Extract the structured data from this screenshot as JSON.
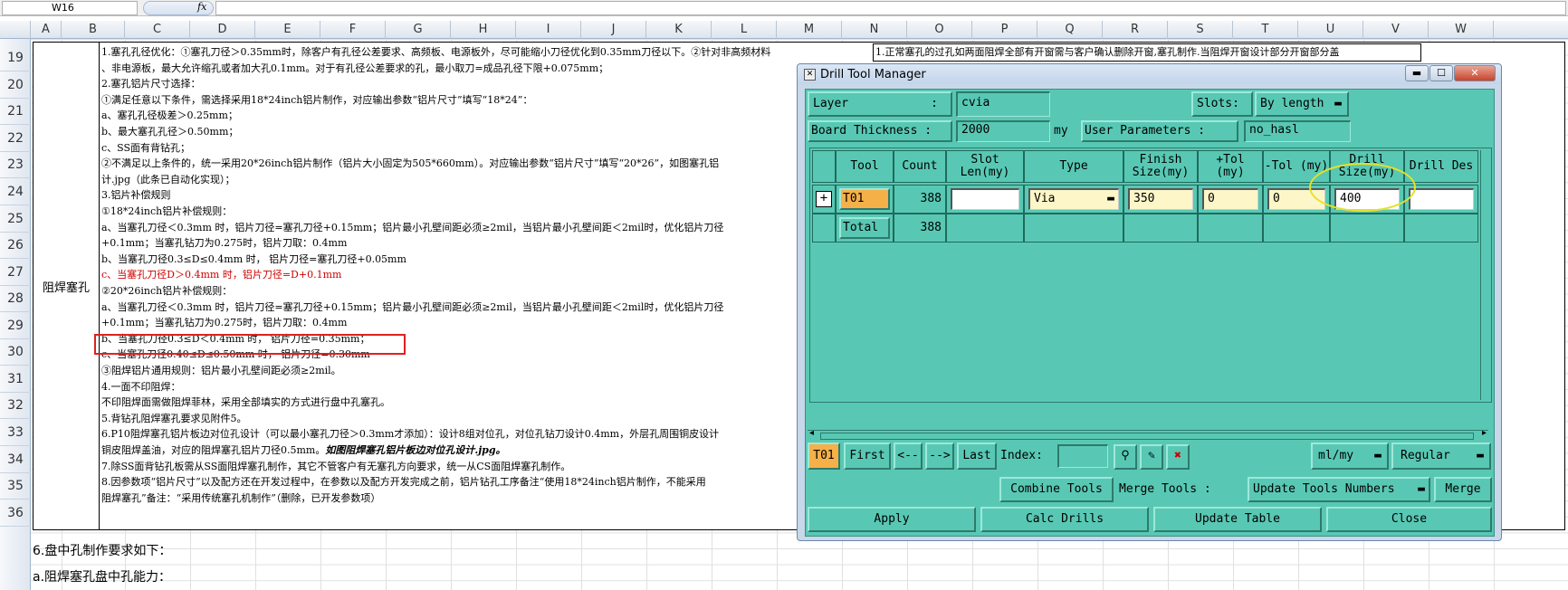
{
  "excel": {
    "name_box": "W16",
    "fx": "fx",
    "columns": [
      "A",
      "B",
      "C",
      "D",
      "E",
      "F",
      "G",
      "H",
      "I",
      "J",
      "K",
      "L",
      "M",
      "N",
      "O",
      "P",
      "Q",
      "R",
      "S",
      "T",
      "U",
      "V",
      "W"
    ],
    "rows": [
      "19",
      "20",
      "21",
      "22",
      "23",
      "24",
      "25",
      "26",
      "27",
      "28",
      "29",
      "30",
      "31",
      "32",
      "33",
      "34",
      "35",
      "36"
    ],
    "merged_label": "阻焊塞孔",
    "lines": [
      "1.塞孔孔径优化：①塞孔刀径＞0.35mm时，除客户有孔径公差要求、高频板、电源板外，尽可能缩小刀径优化到0.35mm刀径以下。②针对非高频材料",
      "、非电源板，最大允许缩孔或者加大孔0.1mm。对于有孔径公差要求的孔，最小取刀=成品孔径下限+0.075mm；",
      "2.塞孔铝片尺寸选择：",
      "①满足任意以下条件，需选择采用18*24inch铝片制作，对应输出参数“铝片尺寸”填写“18*24”：",
      "a、塞孔孔径极差＞0.25mm；",
      "b、最大塞孔孔径＞0.50mm；",
      "c、SS面有背钻孔；",
      "②不满足以上条件的，统一采用20*26inch铝片制作（铝片大小固定为505*660mm）。对应输出参数“铝片尺寸”填写“20*26”，如图塞孔铝",
      "计.jpg（此条已自动化实现）；",
      "3.铝片补偿规则",
      "①18*24inch铝片补偿规则：",
      "a、当塞孔刀径＜0.3mm 时，铝片刀径=塞孔刀径+0.15mm；铝片最小孔壁间距必须≥2mil，当铝片最小孔壁间距＜2mil时，优化铝片刀径",
      "+0.1mm；当塞孔钻刀为0.275时，铝片刀取：0.4mm",
      "b、当塞孔刀径0.3≤D≤0.4mm 时， 铝片刀径=塞孔刀径+0.05mm",
      "c、当塞孔刀径D＞0.4mm 时，铝片刀径=D+0.1mm",
      "②20*26inch铝片补偿规则：",
      "a、当塞孔刀径＜0.3mm 时，铝片刀径=塞孔刀径+0.15mm；铝片最小孔壁间距必须≥2mil，当铝片最小孔壁间距＜2mil时，优化铝片刀径",
      "+0.1mm；当塞孔钻刀为0.275时，铝片刀取：0.4mm",
      "b、当塞孔刀径0.3≤D＜0.4mm 时， 铝片刀径=0.35mm；",
      "c、当塞孔刀径0.40≤D≤0.50mm 时， 铝片刀径=0.30mm",
      "③阻焊铝片通用规则：铝片最小孔壁间距必须≥2mil。",
      "4.一面不印阻焊：",
      "不印阻焊面需做阻焊菲林，采用全部填实的方式进行盘中孔塞孔。",
      "5.背钻孔阻焊塞孔要求见附件5。",
      "6.P10阻焊塞孔铝片板边对位孔设计（可以最小塞孔刀径＞0.3mm才添加）：设计8组对位孔，对位孔钻刀设计0.4mm，外层孔周围铜皮设计",
      "铜皮阻焊盖油，对应的阻焊塞孔铝片刀径0.5mm。",
      "7.除SS面背钻孔板需从SS面阻焊塞孔制作，其它不管客户有无塞孔方向要求，统一从CS面阻焊塞孔制作。",
      "8.因参数项“铝片尺寸”以及配方还在开发过程中，在参数以及配方开发完成之前，铝片钻孔工序备注“使用18*24inch铝片制作，不能采用",
      "阻焊塞孔”备注：“采用传统塞孔机制作”（删除，已开发参数项）"
    ],
    "line6_italic": "如图阻焊塞孔铝片板边对位孔设计.jpg。",
    "note_right": "1.正常塞孔的过孔如两面阻焊全部有开窗需与客户确认删除开窗,塞孔制作.当阻焊开窗设计部分开窗部分盖",
    "below_1": "6.盘中孔制作要求如下：",
    "below_2": "a.阻焊塞孔盘中孔能力："
  },
  "dtm": {
    "title": "Drill Tool Manager",
    "layer_label": "Layer",
    "layer_colon": ":",
    "layer_value": "cvia",
    "slots_label": "Slots:",
    "slots_value": "By length",
    "board_thickness_label": "Board Thickness  :",
    "board_thickness_value": "2000",
    "board_thickness_unit": "my",
    "user_params_label": "User Parameters  :",
    "user_params_value": "no_hasl",
    "headers": [
      "Tool",
      "Count",
      "Slot Len(my)",
      "Type",
      "Finish Size(my)",
      "+Tol (my)",
      "-Tol (my)",
      "Drill Size(my)",
      "Drill Des"
    ],
    "rows": [
      {
        "tool": "T01",
        "count": "388",
        "slot_len": "",
        "type": "Via",
        "finish": "350",
        "plus_tol": "0",
        "minus_tol": "0",
        "drill_size": "400",
        "drill_des": ""
      },
      {
        "tool": "Total",
        "count": "388"
      }
    ],
    "current_tool": "T01",
    "nav": {
      "first": "First",
      "prev": "<--",
      "next": "-->",
      "last": "Last",
      "index_label": "Index:"
    },
    "unit_select": "ml/my",
    "mode_select": "Regular",
    "combine_tools": "Combine Tools",
    "merge_tools_label": "Merge Tools :",
    "update_tools_numbers": "Update Tools Numbers",
    "merge": "Merge",
    "apply": "Apply",
    "calc_drills": "Calc Drills",
    "update_table": "Update Table",
    "close": "Close",
    "accent_teal": "#58c8b4",
    "tool_cell_orange": "#f5b048"
  }
}
